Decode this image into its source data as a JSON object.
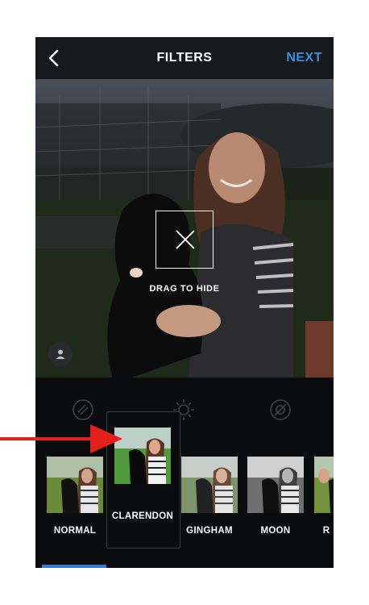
{
  "header": {
    "title": "FILTERS",
    "next_label": "NEXT"
  },
  "photo": {
    "overlay_text": "DRAG TO HIDE"
  },
  "tools": [
    "adjust-icon",
    "brightness-icon",
    "tilt-shift-icon"
  ],
  "filters": [
    {
      "name": "NORMAL",
      "tone": "color"
    },
    {
      "name": "CLARENDON",
      "tone": "color",
      "selected": true
    },
    {
      "name": "GINGHAM",
      "tone": "color"
    },
    {
      "name": "MOON",
      "tone": "grayscale"
    },
    {
      "name": "R",
      "tone": "color"
    }
  ],
  "colors": {
    "accent": "#3a8fe0",
    "arrow": "#e3201b",
    "background": "#0b0c0e",
    "header": "#17181a"
  }
}
